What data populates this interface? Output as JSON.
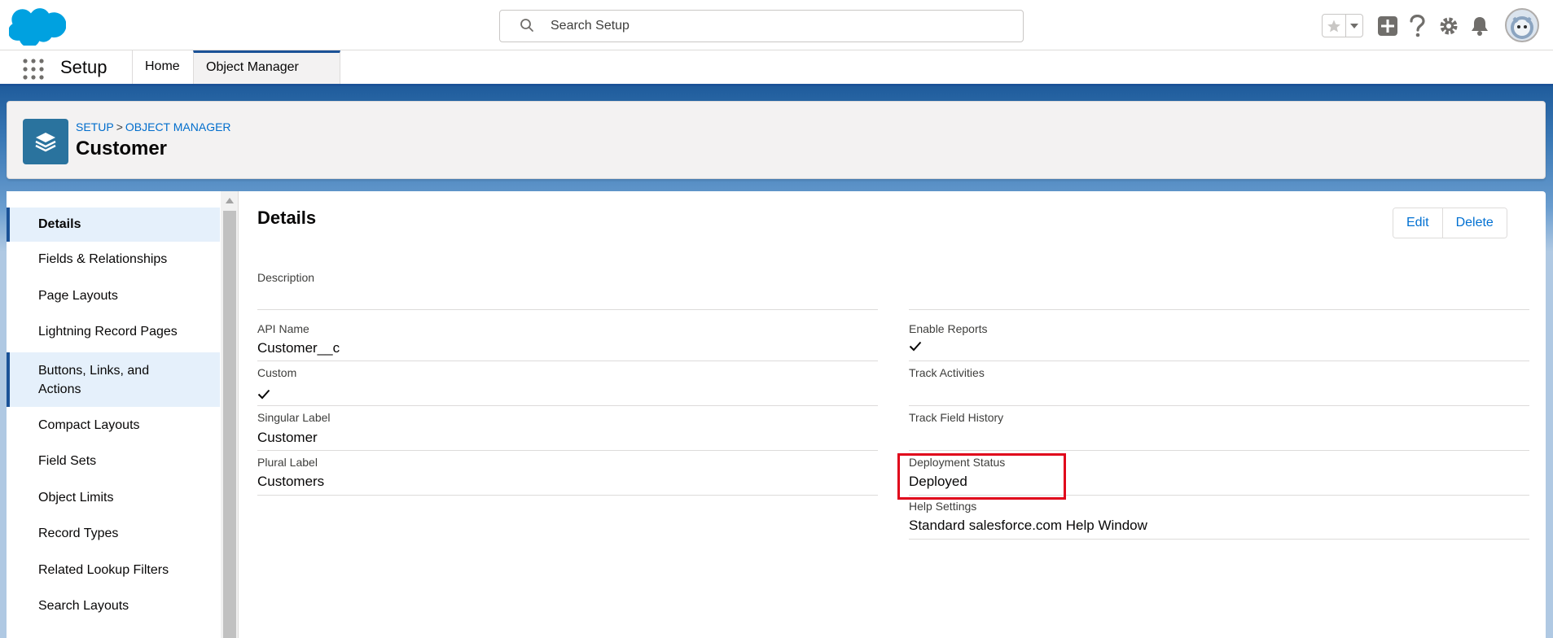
{
  "header": {
    "search_placeholder": "Search Setup"
  },
  "context_bar": {
    "app_name": "Setup",
    "tabs": [
      {
        "label": "Home"
      },
      {
        "label": "Object Manager"
      }
    ]
  },
  "page_header": {
    "breadcrumb_setup": "SETUP",
    "breadcrumb_sep": ">",
    "breadcrumb_object_manager": "OBJECT MANAGER",
    "title": "Customer"
  },
  "sidebar": {
    "items": [
      {
        "label": "Details"
      },
      {
        "label": "Fields & Relationships"
      },
      {
        "label": "Page Layouts"
      },
      {
        "label": "Lightning Record Pages"
      },
      {
        "label": "Buttons, Links, and Actions"
      },
      {
        "label": "Compact Layouts"
      },
      {
        "label": "Field Sets"
      },
      {
        "label": "Object Limits"
      },
      {
        "label": "Record Types"
      },
      {
        "label": "Related Lookup Filters"
      },
      {
        "label": "Search Layouts"
      }
    ]
  },
  "details": {
    "title": "Details",
    "edit_label": "Edit",
    "delete_label": "Delete",
    "left_fields": [
      {
        "label": "Description",
        "value": ""
      },
      {
        "label": "API Name",
        "value": "Customer__c"
      },
      {
        "label": "Custom",
        "value": "checked"
      },
      {
        "label": "Singular Label",
        "value": "Customer"
      },
      {
        "label": "Plural Label",
        "value": "Customers"
      }
    ],
    "right_fields": [
      {
        "label": "Enable Reports",
        "value": "checked"
      },
      {
        "label": "Track Activities",
        "value": ""
      },
      {
        "label": "Track Field History",
        "value": ""
      },
      {
        "label": "Deployment Status",
        "value": "Deployed"
      },
      {
        "label": "Help Settings",
        "value": "Standard salesforce.com Help Window"
      }
    ]
  },
  "colors": {
    "brand_blue": "#1b5297",
    "link_blue": "#006dcc",
    "highlight_red": "#e0041b",
    "object_icon_bg": "#2a739e"
  }
}
